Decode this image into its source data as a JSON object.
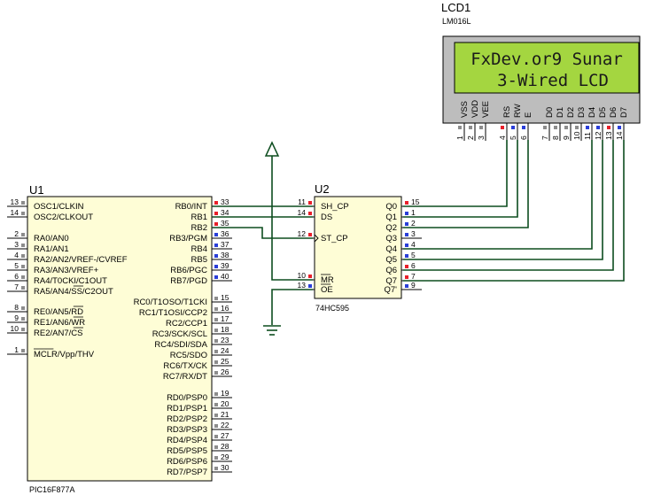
{
  "u1": {
    "ref": "U1",
    "part": "PIC16F877A",
    "left_pins": [
      {
        "num": "13",
        "name": "OSC1/CLKIN"
      },
      {
        "num": "14",
        "name": "OSC2/CLKOUT"
      },
      {
        "num": "2",
        "name": "RA0/AN0"
      },
      {
        "num": "3",
        "name": "RA1/AN1"
      },
      {
        "num": "4",
        "name": "RA2/AN2/VREF-/CVREF"
      },
      {
        "num": "5",
        "name": "RA3/AN3/VREF+"
      },
      {
        "num": "6",
        "name": "RA4/T0CKI/C1OUT"
      },
      {
        "num": "7",
        "name": "RA5/AN4/SS/C2OUT"
      },
      {
        "num": "8",
        "name": "RE0/AN5/RD"
      },
      {
        "num": "9",
        "name": "RE1/AN6/WR"
      },
      {
        "num": "10",
        "name": "RE2/AN7/CS"
      },
      {
        "num": "1",
        "name": "MCLR/Vpp/THV"
      }
    ],
    "right_pins": [
      {
        "num": "33",
        "name": "RB0/INT",
        "state": "high"
      },
      {
        "num": "34",
        "name": "RB1",
        "state": "high"
      },
      {
        "num": "35",
        "name": "RB2",
        "state": "high"
      },
      {
        "num": "36",
        "name": "RB3/PGM",
        "state": "low"
      },
      {
        "num": "37",
        "name": "RB4",
        "state": "low"
      },
      {
        "num": "38",
        "name": "RB5",
        "state": "low"
      },
      {
        "num": "39",
        "name": "RB6/PGC",
        "state": "low"
      },
      {
        "num": "40",
        "name": "RB7/PGD",
        "state": "low"
      },
      {
        "num": "15",
        "name": "RC0/T1OSO/T1CKI",
        "state": "none"
      },
      {
        "num": "16",
        "name": "RC1/T1OSI/CCP2",
        "state": "none"
      },
      {
        "num": "17",
        "name": "RC2/CCP1",
        "state": "none"
      },
      {
        "num": "18",
        "name": "RC3/SCK/SCL",
        "state": "none"
      },
      {
        "num": "23",
        "name": "RC4/SDI/SDA",
        "state": "none"
      },
      {
        "num": "24",
        "name": "RC5/SDO",
        "state": "none"
      },
      {
        "num": "25",
        "name": "RC6/TX/CK",
        "state": "none"
      },
      {
        "num": "26",
        "name": "RC7/RX/DT",
        "state": "none"
      },
      {
        "num": "19",
        "name": "RD0/PSP0",
        "state": "none"
      },
      {
        "num": "20",
        "name": "RD1/PSP1",
        "state": "none"
      },
      {
        "num": "21",
        "name": "RD2/PSP2",
        "state": "none"
      },
      {
        "num": "22",
        "name": "RD3/PSP3",
        "state": "none"
      },
      {
        "num": "27",
        "name": "RD4/PSP4",
        "state": "none"
      },
      {
        "num": "28",
        "name": "RD5/PSP5",
        "state": "none"
      },
      {
        "num": "29",
        "name": "RD6/PSP6",
        "state": "none"
      },
      {
        "num": "30",
        "name": "RD7/PSP7",
        "state": "none"
      }
    ]
  },
  "u2": {
    "ref": "U2",
    "part": "74HC595",
    "left_pins": [
      {
        "num": "11",
        "name": "SH_CP",
        "state": "high"
      },
      {
        "num": "14",
        "name": "DS",
        "state": "high"
      },
      {
        "num": "12",
        "name": "ST_CP",
        "state": "high"
      },
      {
        "num": "10",
        "name": "MR",
        "state": "high"
      },
      {
        "num": "13",
        "name": "OE",
        "state": "low"
      }
    ],
    "right_pins": [
      {
        "num": "15",
        "name": "Q0",
        "state": "high"
      },
      {
        "num": "1",
        "name": "Q1",
        "state": "low"
      },
      {
        "num": "2",
        "name": "Q2",
        "state": "low"
      },
      {
        "num": "3",
        "name": "Q3",
        "state": "low"
      },
      {
        "num": "4",
        "name": "Q4",
        "state": "low"
      },
      {
        "num": "5",
        "name": "Q5",
        "state": "low"
      },
      {
        "num": "6",
        "name": "Q6",
        "state": "high"
      },
      {
        "num": "7",
        "name": "Q7",
        "state": "high"
      },
      {
        "num": "9",
        "name": "Q7'",
        "state": "low"
      }
    ]
  },
  "lcd1": {
    "ref": "LCD1",
    "part": "LM016L",
    "line1": "FxDev.or9 Sunar",
    "line2": "3-Wired LCD",
    "pins": [
      {
        "num": "1",
        "name": "VSS",
        "state": "none"
      },
      {
        "num": "2",
        "name": "VDD",
        "state": "none"
      },
      {
        "num": "3",
        "name": "VEE",
        "state": "none"
      },
      {
        "num": "4",
        "name": "RS",
        "state": "high"
      },
      {
        "num": "5",
        "name": "RW",
        "state": "low"
      },
      {
        "num": "6",
        "name": "E",
        "state": "low"
      },
      {
        "num": "7",
        "name": "D0",
        "state": "none"
      },
      {
        "num": "8",
        "name": "D1",
        "state": "none"
      },
      {
        "num": "9",
        "name": "D2",
        "state": "none"
      },
      {
        "num": "10",
        "name": "D3",
        "state": "none"
      },
      {
        "num": "11",
        "name": "D4",
        "state": "low"
      },
      {
        "num": "12",
        "name": "D5",
        "state": "low"
      },
      {
        "num": "13",
        "name": "D6",
        "state": "high"
      },
      {
        "num": "14",
        "name": "D7",
        "state": "low"
      }
    ]
  },
  "colors": {
    "high": "#e8202a",
    "low": "#2a3ed8",
    "none": "#8c8c8c",
    "wire": "#0d4d1f",
    "lcd_screen": "#a4d640",
    "chip_fill": "#fefdd6"
  },
  "power_symbol": "power-arrow-icon",
  "ground_symbol": "ground-icon"
}
